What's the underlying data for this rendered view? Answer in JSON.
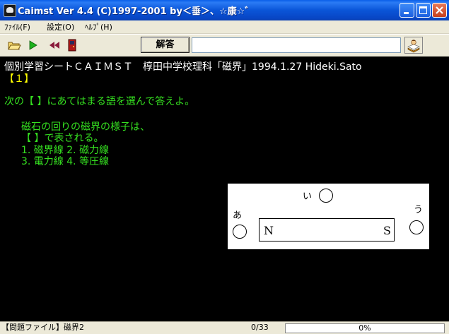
{
  "window": {
    "title": "Caimst Ver 4.4 (C)1997-2001  by＜垂＞、☆康☆゛"
  },
  "menu": {
    "items": [
      {
        "label": "ﾌｧｲﾙ(F)"
      },
      {
        "label": "設定(O)"
      },
      {
        "label": "ﾍﾙﾌﾟ(H)"
      }
    ]
  },
  "toolbar": {
    "answer_label": "解答",
    "answer_value": "",
    "icons": [
      "open-folder-icon",
      "play-icon",
      "rewind-icon",
      "exit-door-icon",
      "help-book-icon"
    ]
  },
  "content": {
    "header": "個別学習シートＣＡＩＭＳＴ　椁田中学校理科「磁界」1994.1.27  Hideki.Sato",
    "question_number": "【１】",
    "instruction": "次の【  】にあてはまる語を選んで答えよ。",
    "question_lines": [
      "磁石の回りの磁界の様子は、",
      "【  】で表される。",
      "1.  磁界線    2.  磁力線",
      "3.  電力線    4.  等圧線"
    ]
  },
  "figure": {
    "label_a": "あ",
    "label_i": "い",
    "label_u": "う",
    "pole_n": "N",
    "pole_s": "S"
  },
  "status": {
    "file": "【問題ファイル】磁界2",
    "count": "0/33",
    "progress_text": "0%",
    "progress_value": 0
  },
  "colors": {
    "title_bar": "#0a55d8",
    "background": "#000000",
    "header_text": "#ffffff",
    "question_number": "#ffff00",
    "question_text": "#35e020"
  }
}
